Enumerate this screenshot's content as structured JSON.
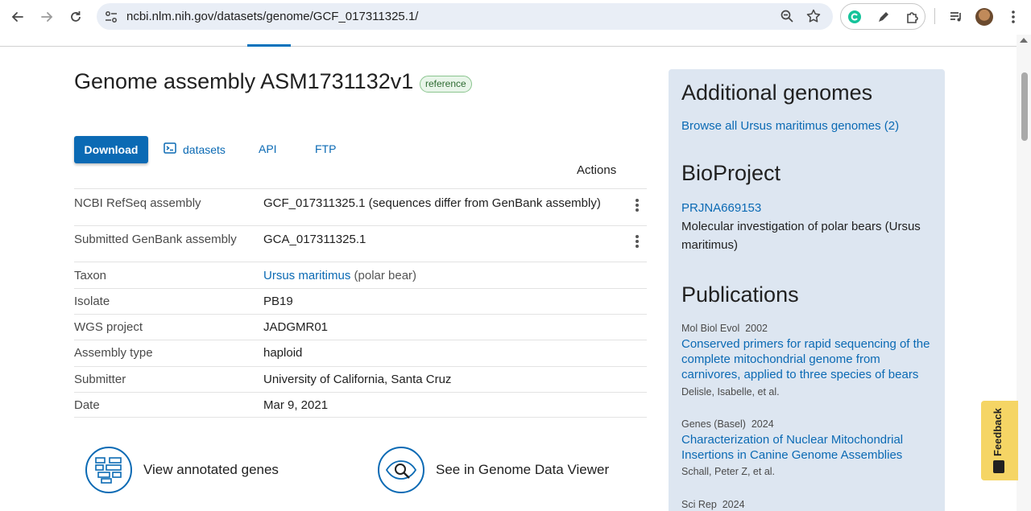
{
  "browser": {
    "url": "ncbi.nlm.nih.gov/datasets/genome/GCF_017311325.1/"
  },
  "page": {
    "title": "Genome assembly ASM1731132v1",
    "badge": "reference",
    "download_label": "Download",
    "datasets_label": "datasets",
    "api_label": "API",
    "ftp_label": "FTP",
    "actions_label": "Actions"
  },
  "rows": [
    {
      "label": "NCBI RefSeq assembly",
      "value": "GCF_017311325.1 (sequences differ from GenBank assembly)"
    },
    {
      "label": "Submitted GenBank assembly",
      "value": "GCA_017311325.1"
    },
    {
      "label": "Taxon",
      "value_link": "Ursus maritimus",
      "value_extra": " (polar bear)"
    },
    {
      "label": "Isolate",
      "value": "PB19"
    },
    {
      "label": "WGS project",
      "value_link": "JADGMR01"
    },
    {
      "label": "Assembly type",
      "value": "haploid"
    },
    {
      "label": "Submitter",
      "value": "University of California, Santa Cruz"
    },
    {
      "label": "Date",
      "value": "Mar 9, 2021"
    }
  ],
  "features": {
    "annotated_genes": "View annotated genes",
    "genome_viewer": "See in Genome Data Viewer"
  },
  "sidebar": {
    "additional_title": "Additional genomes",
    "browse_link": "Browse all Ursus maritimus genomes (2)",
    "bioproject_title": "BioProject",
    "bioproject_id": "PRJNA669153",
    "bioproject_desc": "Molecular investigation of polar bears (Ursus maritimus)",
    "publications_title": "Publications",
    "publications": [
      {
        "journal": "Mol Biol Evol",
        "year": "2002",
        "title": "Conserved primers for rapid sequencing of the complete mitochondrial genome from carnivores, applied to three species of bears",
        "authors": "Delisle, Isabelle, et al."
      },
      {
        "journal": "Genes (Basel)",
        "year": "2024",
        "title": "Characterization of Nuclear Mitochondrial Insertions in Canine Genome Assemblies",
        "authors": "Schall, Peter Z, et al."
      },
      {
        "journal": "Sci Rep",
        "year": "2024"
      }
    ]
  },
  "feedback_label": "Feedback",
  "colors": {
    "accent": "#0b6ab4",
    "sidebar_bg": "#dde6f1",
    "feedback_bg": "#f5d565",
    "badge_bg": "#e8f5e9"
  }
}
